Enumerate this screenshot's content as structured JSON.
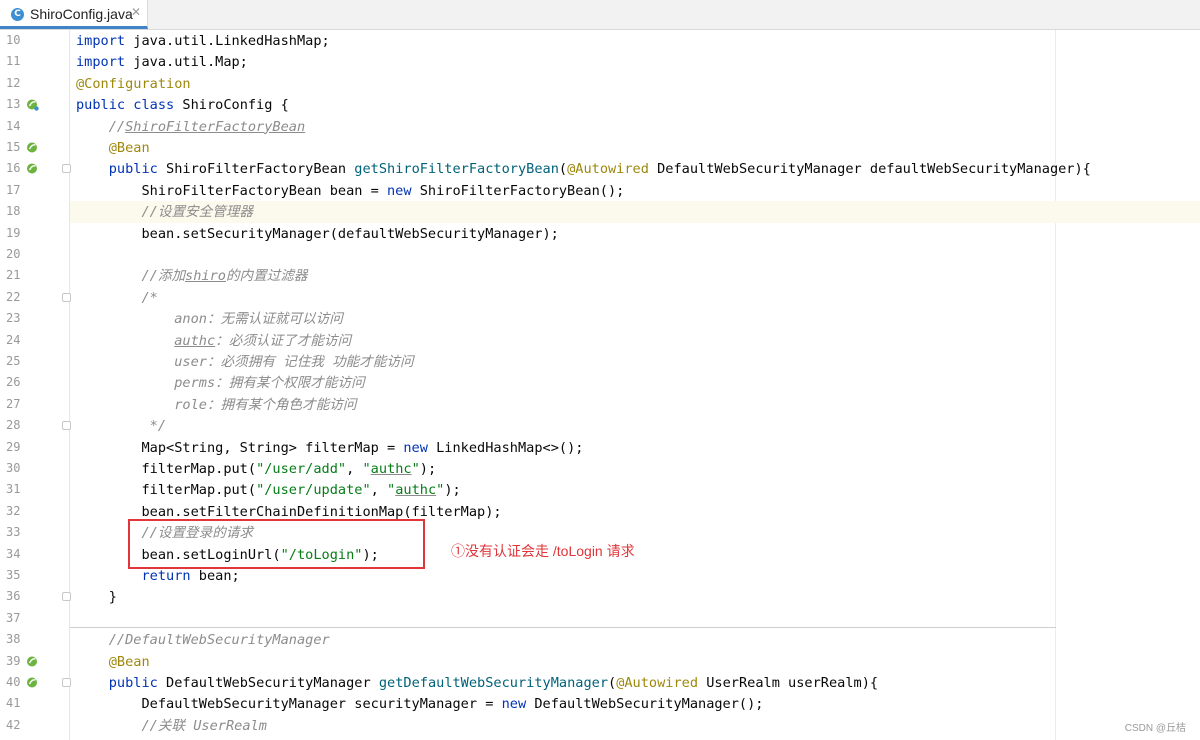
{
  "tab": {
    "label": "ShiroConfig.java",
    "icon": "java-class-icon",
    "close": "✕"
  },
  "annotation": "①没有认证会走 /toLogin 请求",
  "watermark": "CSDN @丘桔",
  "line_numbers": [
    "10",
    "11",
    "12",
    "13",
    "14",
    "15",
    "16",
    "17",
    "18",
    "19",
    "20",
    "21",
    "22",
    "23",
    "24",
    "25",
    "26",
    "27",
    "28",
    "29",
    "30",
    "31",
    "32",
    "33",
    "34",
    "35",
    "36",
    "37",
    "38",
    "39",
    "40",
    "41",
    "42"
  ],
  "code": {
    "l10": [
      "import",
      " java.util.LinkedHashMap;"
    ],
    "l11": [
      "import",
      " java.util.Map;"
    ],
    "l12": [
      "@Configuration"
    ],
    "l13": [
      "public class",
      " ShiroConfig {"
    ],
    "l14": [
      "    //",
      "ShiroFilterFactoryBean"
    ],
    "l15": [
      "    ",
      "@Bean"
    ],
    "l16": [
      "    ",
      "public",
      " ShiroFilterFactoryBean ",
      "getShiroFilterFactoryBean",
      "(",
      "@Autowired",
      " DefaultWebSecurityManager defaultWebSecurityManager){"
    ],
    "l17": [
      "        ShiroFilterFactoryBean bean = ",
      "new",
      " ShiroFilterFactoryBean();"
    ],
    "l18": [
      "        ",
      "//设置安全管理器"
    ],
    "l19": [
      "        bean.setSecurityManager(defaultWebSecurityManager);"
    ],
    "l20": [
      ""
    ],
    "l21": [
      "        ",
      "//添加",
      "shiro",
      "的内置过滤器"
    ],
    "l22": [
      "        ",
      "/*"
    ],
    "l23": [
      "            ",
      "anon：无需认证就可以访问"
    ],
    "l24": [
      "            ",
      "authc",
      "：必须认证了才能访问"
    ],
    "l25": [
      "            ",
      "user：必须拥有 记住我 功能才能访问"
    ],
    "l26": [
      "            ",
      "perms：拥有某个权限才能访问"
    ],
    "l27": [
      "            ",
      "role：拥有某个角色才能访问"
    ],
    "l28": [
      "         ",
      "*/"
    ],
    "l29": [
      "        Map<String, String> filterMap = ",
      "new",
      " LinkedHashMap<>();"
    ],
    "l30": [
      "        filterMap.put(",
      "\"/user/add\"",
      ", ",
      "\"",
      "authc",
      "\"",
      ");"
    ],
    "l31": [
      "        filterMap.put(",
      "\"/user/update\"",
      ", ",
      "\"",
      "authc",
      "\"",
      ");"
    ],
    "l32": [
      "        bean.setFilterChainDefinitionMap(filterMap);"
    ],
    "l33": [
      "        ",
      "//设置登录的请求"
    ],
    "l34": [
      "        bean.setLoginUrl(",
      "\"/toLogin\"",
      ");"
    ],
    "l35": [
      "        ",
      "return",
      " bean;"
    ],
    "l36": [
      "    }"
    ],
    "l37": [
      ""
    ],
    "l38": [
      "    ",
      "//DefaultWebSecurityManager"
    ],
    "l39": [
      "    ",
      "@Bean"
    ],
    "l40": [
      "    ",
      "public",
      " DefaultWebSecurityManager ",
      "getDefaultWebSecurityManager",
      "(",
      "@Autowired",
      " UserRealm userRealm){"
    ],
    "l41": [
      "        DefaultWebSecurityManager securityManager = ",
      "new",
      " DefaultWebSecurityManager();"
    ],
    "l42": [
      "        ",
      "//关联 UserRealm"
    ]
  },
  "colors": {
    "keyword": "#0033b3",
    "annotation": "#9e880d",
    "string": "#067d17",
    "comment": "#8c8c8c",
    "method": "#00627a",
    "highlight": "#fcfaed",
    "redbox": "#e0353a"
  }
}
